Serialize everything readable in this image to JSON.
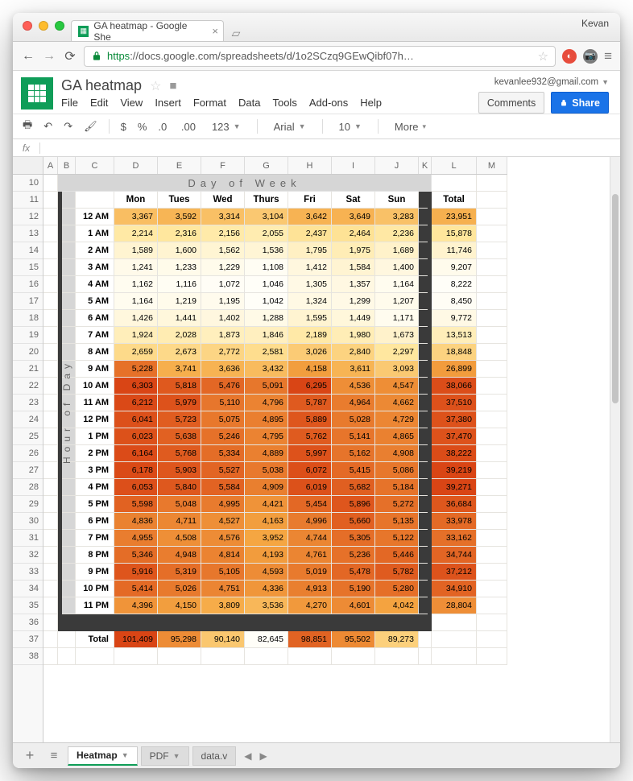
{
  "browser": {
    "profile": "Kevan",
    "tab_title": "GA heatmap - Google She",
    "url_proto": "https",
    "url_rest": "://docs.google.com/spreadsheets/d/1o2SCzq9GEwQibf07h…"
  },
  "docs": {
    "title": "GA heatmap",
    "account": "kevanlee932@gmail.com",
    "menus": [
      "File",
      "Edit",
      "View",
      "Insert",
      "Format",
      "Data",
      "Tools",
      "Add-ons",
      "Help"
    ],
    "comments_label": "Comments",
    "share_label": "Share",
    "font": "Arial",
    "font_size": "10",
    "more_label": "More"
  },
  "fx": {
    "label": "fx"
  },
  "columns": [
    "A",
    "B",
    "C",
    "D",
    "E",
    "F",
    "G",
    "H",
    "I",
    "J",
    "K",
    "L",
    "M"
  ],
  "row_numbers": [
    "10",
    "11",
    "12",
    "13",
    "14",
    "15",
    "16",
    "17",
    "18",
    "19",
    "20",
    "21",
    "22",
    "23",
    "24",
    "25",
    "26",
    "27",
    "28",
    "29",
    "30",
    "31",
    "32",
    "33",
    "34",
    "35",
    "36",
    "37",
    "38"
  ],
  "banner": "Day of Week",
  "vbanner": "Hour of Day",
  "day_headers": [
    "Mon",
    "Tues",
    "Wed",
    "Thurs",
    "Fri",
    "Sat",
    "Sun"
  ],
  "total_hdr": "Total",
  "hours": [
    "12 AM",
    "1 AM",
    "2 AM",
    "3 AM",
    "4 AM",
    "5 AM",
    "6 AM",
    "7 AM",
    "8 AM",
    "9 AM",
    "10 AM",
    "11 AM",
    "12 PM",
    "1 PM",
    "2 PM",
    "3 PM",
    "4 PM",
    "5 PM",
    "6 PM",
    "7 PM",
    "8 PM",
    "9 PM",
    "10 PM",
    "11 PM"
  ],
  "total_row_label": "Total",
  "chart_data": {
    "type": "heatmap",
    "title": "GA heatmap",
    "xlabel": "Day of Week",
    "ylabel": "Hour of Day",
    "x_categories": [
      "Mon",
      "Tues",
      "Wed",
      "Thurs",
      "Fri",
      "Sat",
      "Sun"
    ],
    "y_categories": [
      "12 AM",
      "1 AM",
      "2 AM",
      "3 AM",
      "4 AM",
      "5 AM",
      "6 AM",
      "7 AM",
      "8 AM",
      "9 AM",
      "10 AM",
      "11 AM",
      "12 PM",
      "1 PM",
      "2 PM",
      "3 PM",
      "4 PM",
      "5 PM",
      "6 PM",
      "7 PM",
      "8 PM",
      "9 PM",
      "10 PM",
      "11 PM"
    ],
    "values": [
      [
        3367,
        3592,
        3314,
        3104,
        3642,
        3649,
        3283
      ],
      [
        2214,
        2316,
        2156,
        2055,
        2437,
        2464,
        2236
      ],
      [
        1589,
        1600,
        1562,
        1536,
        1795,
        1975,
        1689
      ],
      [
        1241,
        1233,
        1229,
        1108,
        1412,
        1584,
        1400
      ],
      [
        1162,
        1116,
        1072,
        1046,
        1305,
        1357,
        1164
      ],
      [
        1164,
        1219,
        1195,
        1042,
        1324,
        1299,
        1207
      ],
      [
        1426,
        1441,
        1402,
        1288,
        1595,
        1449,
        1171
      ],
      [
        1924,
        2028,
        1873,
        1846,
        2189,
        1980,
        1673
      ],
      [
        2659,
        2673,
        2772,
        2581,
        3026,
        2840,
        2297
      ],
      [
        5228,
        3741,
        3636,
        3432,
        4158,
        3611,
        3093
      ],
      [
        6303,
        5818,
        5476,
        5091,
        6295,
        4536,
        4547
      ],
      [
        6212,
        5979,
        5110,
        4796,
        5787,
        4964,
        4662
      ],
      [
        6041,
        5723,
        5075,
        4895,
        5889,
        5028,
        4729
      ],
      [
        6023,
        5638,
        5246,
        4795,
        5762,
        5141,
        4865
      ],
      [
        6164,
        5768,
        5334,
        4889,
        5997,
        5162,
        4908
      ],
      [
        6178,
        5903,
        5527,
        5038,
        6072,
        5415,
        5086
      ],
      [
        6053,
        5840,
        5584,
        4909,
        6019,
        5682,
        5184
      ],
      [
        5598,
        5048,
        4995,
        4421,
        5454,
        5896,
        5272
      ],
      [
        4836,
        4711,
        4527,
        4163,
        4996,
        5660,
        5135
      ],
      [
        4955,
        4508,
        4576,
        3952,
        4744,
        5305,
        5122
      ],
      [
        5346,
        4948,
        4814,
        4193,
        4761,
        5236,
        5446
      ],
      [
        5916,
        5319,
        5105,
        4593,
        5019,
        5478,
        5782
      ],
      [
        5414,
        5026,
        4751,
        4336,
        4913,
        5190,
        5280
      ],
      [
        4396,
        4150,
        3809,
        3536,
        4270,
        4601,
        4042
      ]
    ],
    "row_totals": [
      23951,
      15878,
      11746,
      9207,
      8222,
      8450,
      9772,
      13513,
      18848,
      26899,
      38066,
      37510,
      37380,
      37470,
      38222,
      39219,
      39271,
      36684,
      33978,
      33162,
      34744,
      37212,
      34910,
      28804
    ],
    "col_totals": [
      101409,
      95298,
      90140,
      82645,
      98851,
      95502,
      89273
    ]
  },
  "sheet_tabs": {
    "active": "Heatmap",
    "others": [
      "PDF",
      "data.v"
    ]
  }
}
